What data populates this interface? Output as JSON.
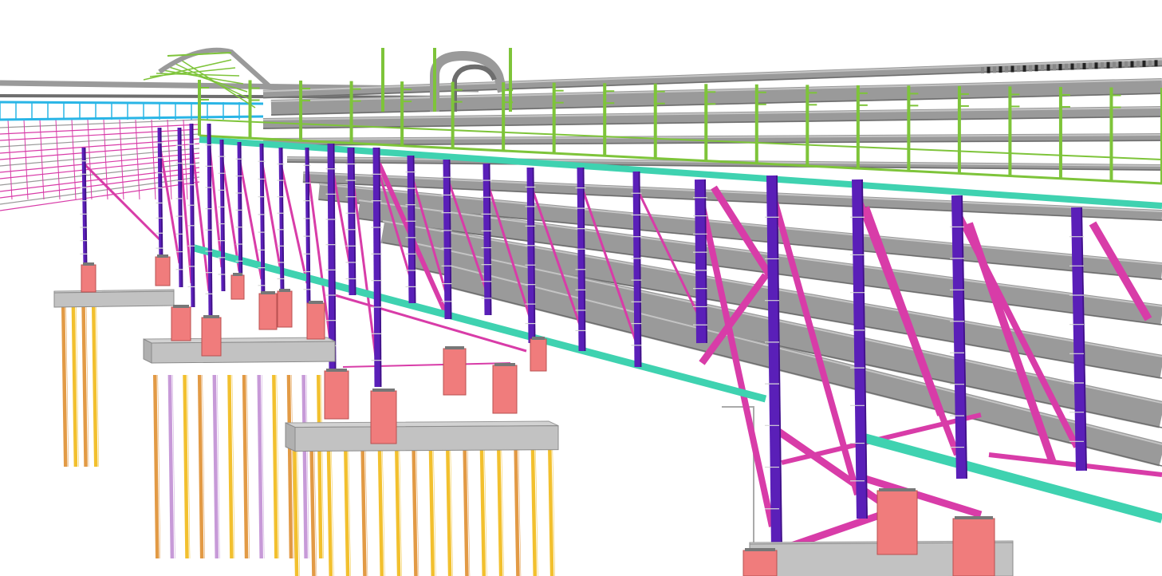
{
  "viewport": {
    "background": "#ffffff"
  },
  "model": {
    "colors": {
      "column": "#5a1fb8",
      "column_edge": "#3d1080",
      "bracing": "#d83ca8",
      "longitudinal_beam": "#3fd2b0",
      "handrail": "#7ec43a",
      "cyan_walkway": "#29b5e6",
      "pipe": "#9a9a9a",
      "pipe_dark": "#6e6e6e",
      "pedestal": "#f07c7c",
      "pile_cap": "#d2d2d2",
      "pile_cap_side": "#b0b0b0",
      "pile_orange": "#e29a45",
      "pile_yellow": "#f2c02e",
      "pile_lilac": "#c79ad8"
    },
    "icons": [
      "pipe-rack-structure",
      "pipe-bundle",
      "pile-foundation",
      "stair-tower"
    ]
  }
}
